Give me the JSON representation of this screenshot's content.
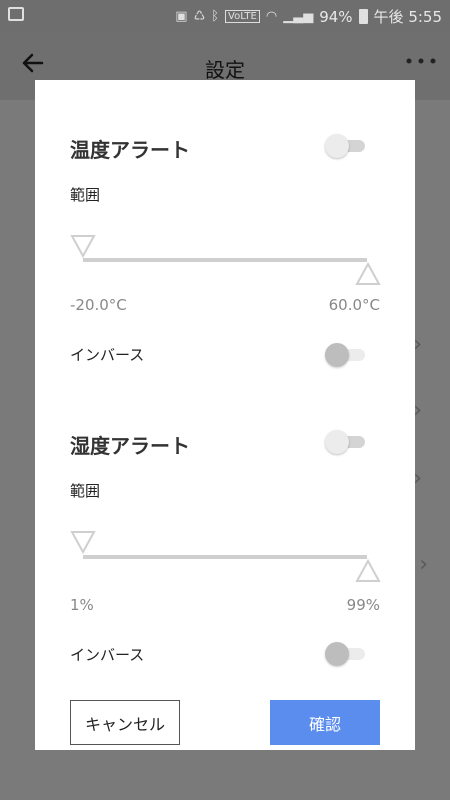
{
  "status_bar": {
    "battery_percent": "94%",
    "time": "午後 5:55",
    "icons": [
      "image-icon",
      "android-icon",
      "recycle-icon",
      "bluetooth-icon",
      "volte-icon",
      "wifi-icon",
      "signal-icon",
      "battery-icon"
    ]
  },
  "app_bar": {
    "title": "設定",
    "back_icon": "arrow-left-icon",
    "menu_icon": "more-horizontal-icon"
  },
  "dialog": {
    "temperature": {
      "title": "温度アラート",
      "enabled": false,
      "range_label": "範囲",
      "min": "-20.0°C",
      "max": "60.0°C",
      "inverse_label": "インバース",
      "inverse_enabled": false
    },
    "humidity": {
      "title": "湿度アラート",
      "enabled": false,
      "range_label": "範囲",
      "min": "1%",
      "max": "99%",
      "inverse_label": "インバース",
      "inverse_enabled": false
    },
    "cancel_label": "キャンセル",
    "confirm_label": "確認",
    "colors": {
      "confirm_button": "#5b8def",
      "slider_track": "#cfcfcf",
      "overlay": "#777777"
    }
  }
}
